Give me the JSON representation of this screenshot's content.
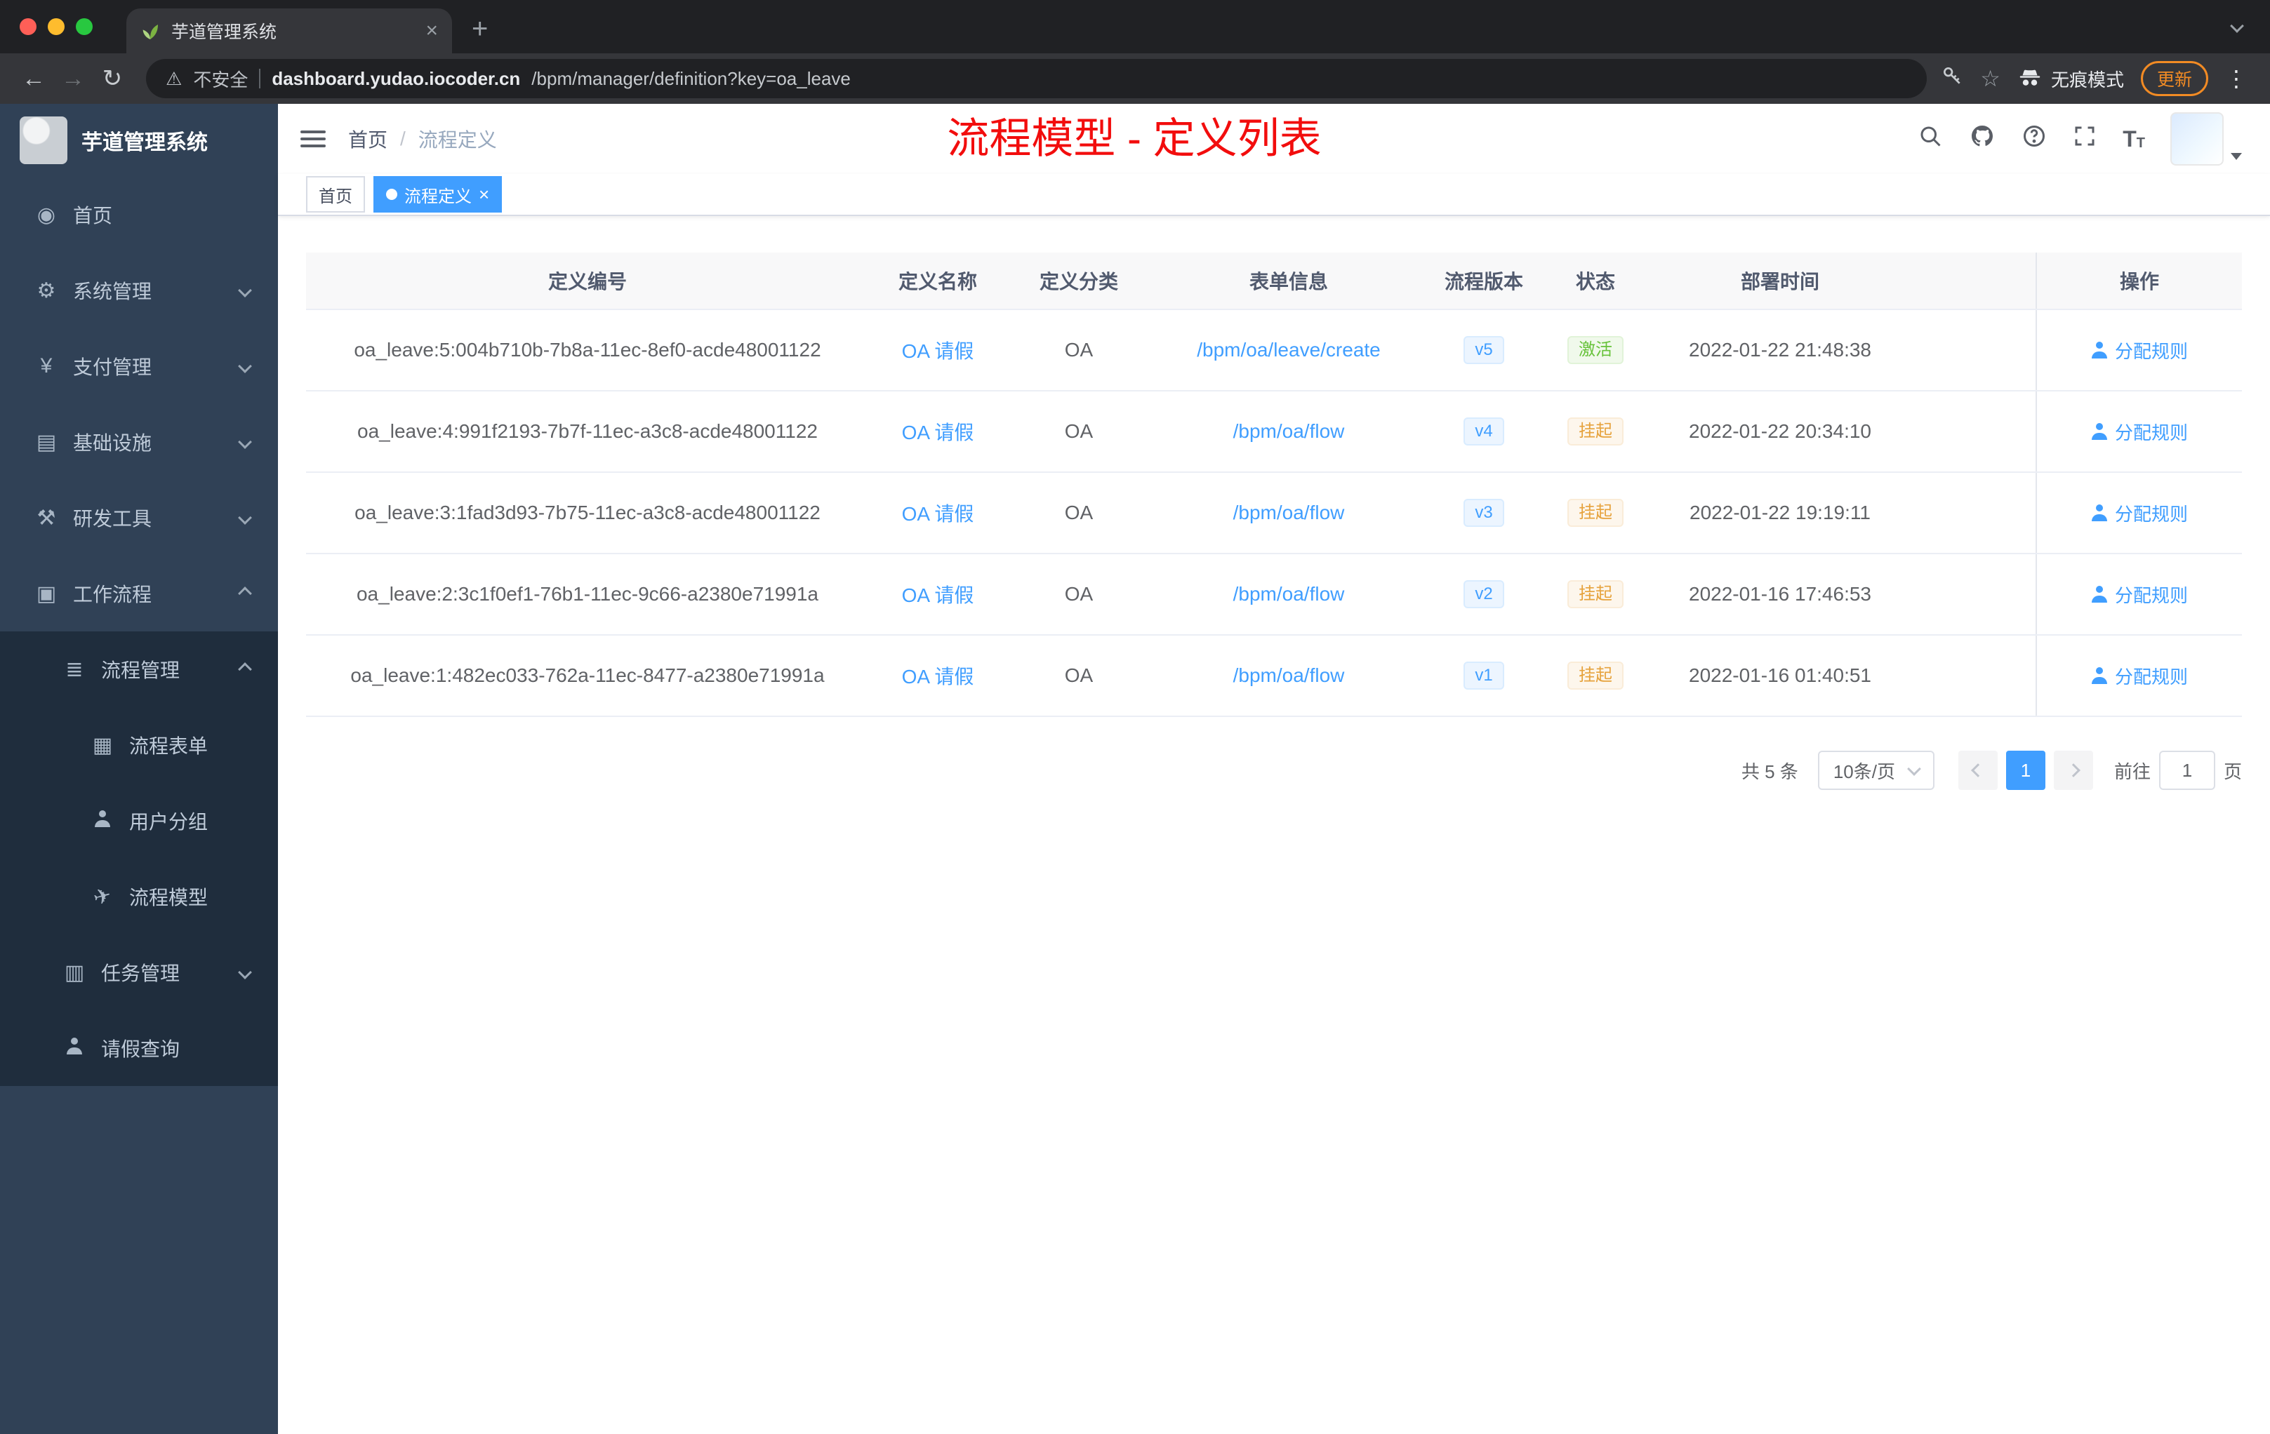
{
  "colors": {
    "accent": "#409eff",
    "annotation_red": "#f20d0d",
    "success": "#67c23a",
    "warning": "#e6a23c",
    "sidebar_bg": "#304156",
    "submenu_bg": "#1f2d3d"
  },
  "browser": {
    "tab_title": "芋道管理系统",
    "new_tab_icon": "+",
    "tab_close_icon": "×",
    "back_icon": "←",
    "forward_icon": "→",
    "reload_icon": "↻",
    "warning_icon": "⚠",
    "security_label": "不安全",
    "url_host": "dashboard.yudao.iocoder.cn",
    "url_path": "/bpm/manager/definition?key=oa_leave",
    "star_icon": "☆",
    "incognito_label": "无痕模式",
    "update_label": "更新",
    "menu_icon": "⋮"
  },
  "sidebar": {
    "brand": "芋道管理系统",
    "items": [
      {
        "label": "首页",
        "glyph": "◉"
      },
      {
        "label": "系统管理",
        "glyph": "⚙"
      },
      {
        "label": "支付管理",
        "glyph": "¥"
      },
      {
        "label": "基础设施",
        "glyph": "▤"
      },
      {
        "label": "研发工具",
        "glyph": "⚒"
      },
      {
        "label": "工作流程",
        "glyph": "▣"
      },
      {
        "label": "流程管理",
        "glyph": "≣"
      },
      {
        "label": "流程表单",
        "glyph": "▦"
      },
      {
        "label": "用户分组",
        "glyph": ""
      },
      {
        "label": "流程模型",
        "glyph": "✈"
      },
      {
        "label": "任务管理",
        "glyph": "▥"
      },
      {
        "label": "请假查询",
        "glyph": ""
      }
    ]
  },
  "header": {
    "breadcrumb_home": "首页",
    "breadcrumb_sep": "/",
    "breadcrumb_current": "流程定义",
    "annotation": "流程模型 - 定义列表",
    "fontsize_icon_big": "T",
    "fontsize_icon_small": "T"
  },
  "tags": {
    "home": "首页",
    "active": "流程定义",
    "close_icon": "×"
  },
  "table": {
    "columns": {
      "id": "定义编号",
      "name": "定义名称",
      "category": "定义分类",
      "form": "表单信息",
      "version": "流程版本",
      "status": "状态",
      "time": "部署时间",
      "action": "操作"
    },
    "rows": [
      {
        "id": "oa_leave:5:004b710b-7b8a-11ec-8ef0-acde48001122",
        "name": "OA 请假",
        "category": "OA",
        "form": "/bpm/oa/leave/create",
        "version": "v5",
        "status": "激活",
        "time": "2022-01-22 21:48:38",
        "action": "分配规则"
      },
      {
        "id": "oa_leave:4:991f2193-7b7f-11ec-a3c8-acde48001122",
        "name": "OA 请假",
        "category": "OA",
        "form": "/bpm/oa/flow",
        "version": "v4",
        "status": "挂起",
        "time": "2022-01-22 20:34:10",
        "action": "分配规则"
      },
      {
        "id": "oa_leave:3:1fad3d93-7b75-11ec-a3c8-acde48001122",
        "name": "OA 请假",
        "category": "OA",
        "form": "/bpm/oa/flow",
        "version": "v3",
        "status": "挂起",
        "time": "2022-01-22 19:19:11",
        "action": "分配规则"
      },
      {
        "id": "oa_leave:2:3c1f0ef1-76b1-11ec-9c66-a2380e71991a",
        "name": "OA 请假",
        "category": "OA",
        "form": "/bpm/oa/flow",
        "version": "v2",
        "status": "挂起",
        "time": "2022-01-16 17:46:53",
        "action": "分配规则"
      },
      {
        "id": "oa_leave:1:482ec033-762a-11ec-8477-a2380e71991a",
        "name": "OA 请假",
        "category": "OA",
        "form": "/bpm/oa/flow",
        "version": "v1",
        "status": "挂起",
        "time": "2022-01-16 01:40:51",
        "action": "分配规则"
      }
    ]
  },
  "pagination": {
    "total": "共 5 条",
    "page_size": "10条/页",
    "current_page": "1",
    "goto_label": "前往",
    "goto_value": "1",
    "page_unit": "页"
  }
}
